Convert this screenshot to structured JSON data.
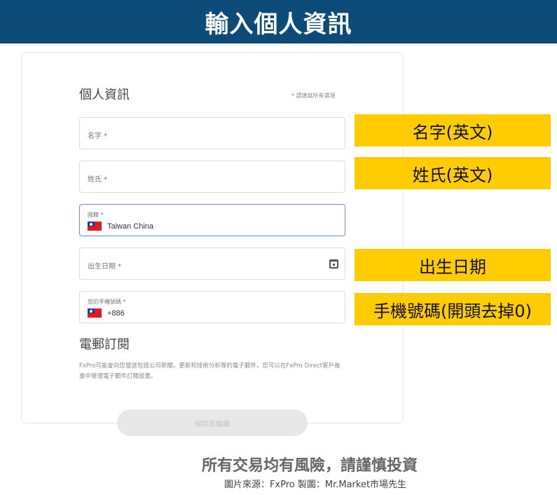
{
  "banner": {
    "title": "輸入個人資訊"
  },
  "form": {
    "section_title": "個人資訊",
    "required_note": "* 請填寫所有選項",
    "fields": [
      {
        "label": "名字 *"
      },
      {
        "label": "姓氏 *"
      },
      {
        "label": "國籍 *",
        "value": "Taiwan China",
        "flag": "taiwan-flag"
      },
      {
        "label": "出生日期 *",
        "icon": "calendar-icon"
      },
      {
        "label": "您的手機號碼 *",
        "value": "+886",
        "flag": "taiwan-flag"
      }
    ],
    "email_title": "電郵訂閱",
    "email_desc": "FxPro可能會向您發送包括公司新聞，更新和技術分析等的電子郵件，您可以在FxPro Direct客戶後臺中管理電子郵件訂閱設置。",
    "save_label": "保存並繼續"
  },
  "annotations": {
    "first_name": "名字(英文)",
    "last_name": "姓氏(英文)",
    "birth_date": "出生日期",
    "phone": "手機號碼(開頭去掉0)"
  },
  "footer": {
    "risk_warning": "所有交易均有風險，請謹慎投資",
    "source_credit": "圖片來源：FxPro 製圖：Mr.Market市場先生"
  },
  "colors": {
    "banner": "#0c4a78",
    "annotation": "#ffcc00",
    "focus_border": "#6b8fd6"
  }
}
